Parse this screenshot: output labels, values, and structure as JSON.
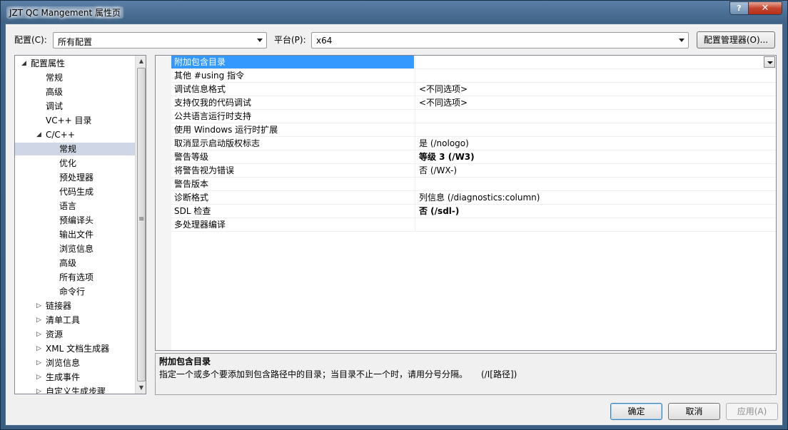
{
  "window": {
    "title": "JZT QC Mangement 属性页"
  },
  "titlebar": {
    "help_glyph": "?",
    "close_glyph": "✕"
  },
  "config": {
    "label": "配置(C):",
    "value": "所有配置"
  },
  "platform": {
    "label": "平台(P):",
    "value": "x64"
  },
  "config_manager_button": "配置管理器(O)...",
  "tree": {
    "items": [
      {
        "label": "配置属性",
        "toggle": "◢"
      },
      {
        "label": "常规"
      },
      {
        "label": "高级"
      },
      {
        "label": "调试"
      },
      {
        "label": "VC++ 目录"
      },
      {
        "label": "C/C++",
        "toggle": "◢"
      },
      {
        "label": "常规",
        "selected": true
      },
      {
        "label": "优化"
      },
      {
        "label": "预处理器"
      },
      {
        "label": "代码生成"
      },
      {
        "label": "语言"
      },
      {
        "label": "预编译头"
      },
      {
        "label": "输出文件"
      },
      {
        "label": "浏览信息"
      },
      {
        "label": "高级"
      },
      {
        "label": "所有选项"
      },
      {
        "label": "命令行"
      },
      {
        "label": "链接器",
        "toggle": "▷"
      },
      {
        "label": "清单工具",
        "toggle": "▷"
      },
      {
        "label": "资源",
        "toggle": "▷"
      },
      {
        "label": "XML 文档生成器",
        "toggle": "▷"
      },
      {
        "label": "浏览信息",
        "toggle": "▷"
      },
      {
        "label": "生成事件",
        "toggle": "▷"
      },
      {
        "label": "自定义生成步骤",
        "toggle": "▷"
      }
    ],
    "scroll_up_glyph": "▲",
    "scroll_down_glyph": "▼",
    "scroll_grip_glyph": "≡"
  },
  "properties": [
    {
      "name": "附加包含目录",
      "value": "",
      "selected": true
    },
    {
      "name": "其他 #using 指令",
      "value": ""
    },
    {
      "name": "调试信息格式",
      "value": "<不同选项>"
    },
    {
      "name": "支持仅我的代码调试",
      "value": "<不同选项>"
    },
    {
      "name": "公共语言运行时支持",
      "value": ""
    },
    {
      "name": "使用 Windows 运行时扩展",
      "value": ""
    },
    {
      "name": "取消显示启动版权标志",
      "value": "是 (/nologo)"
    },
    {
      "name": "警告等级",
      "value": "等级 3 (/W3)",
      "bold": true
    },
    {
      "name": "将警告视为错误",
      "value": "否 (/WX-)"
    },
    {
      "name": "警告版本",
      "value": ""
    },
    {
      "name": "诊断格式",
      "value": "列信息 (/diagnostics:column)"
    },
    {
      "name": "SDL 检查",
      "value": "否 (/sdl-)",
      "bold": true
    },
    {
      "name": "多处理器编译",
      "value": ""
    }
  ],
  "description": {
    "title": "附加包含目录",
    "text": "指定一个或多个要添加到包含路径中的目录；当目录不止一个时，请用分号分隔。",
    "switch": "(/I[路径])"
  },
  "buttons": {
    "ok": "确定",
    "cancel": "取消",
    "apply": "应用(A)"
  }
}
